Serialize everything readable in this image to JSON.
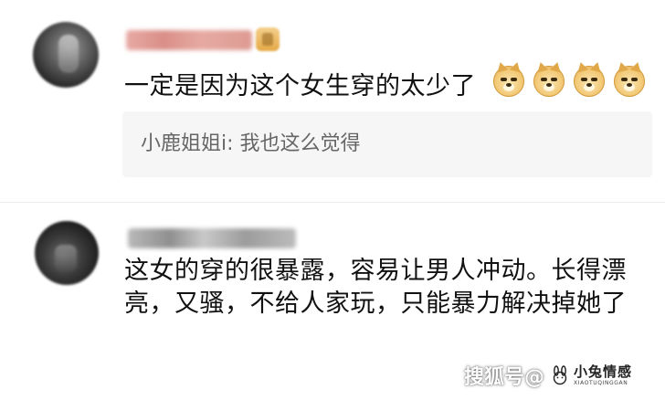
{
  "comments": [
    {
      "text": "一定是因为这个女生穿的太少了",
      "emojis": [
        "doge",
        "doge",
        "doge",
        "doge"
      ],
      "reply": "小鹿姐姐i: 我也这么觉得"
    },
    {
      "text": "这女的穿的很暴露，容易让男人冲动。长得漂亮，又骚，不给人家玩，只能暴力解决掉她了"
    }
  ],
  "watermark": {
    "site": "搜狐号@",
    "brand_name": "小兔情感",
    "brand_sub": "XIAOTUQINGGAN"
  },
  "colors": {
    "background": "#ffffff",
    "reply_background": "#f6f6f6",
    "reply_text": "#666666",
    "comment_text": "#111111"
  }
}
